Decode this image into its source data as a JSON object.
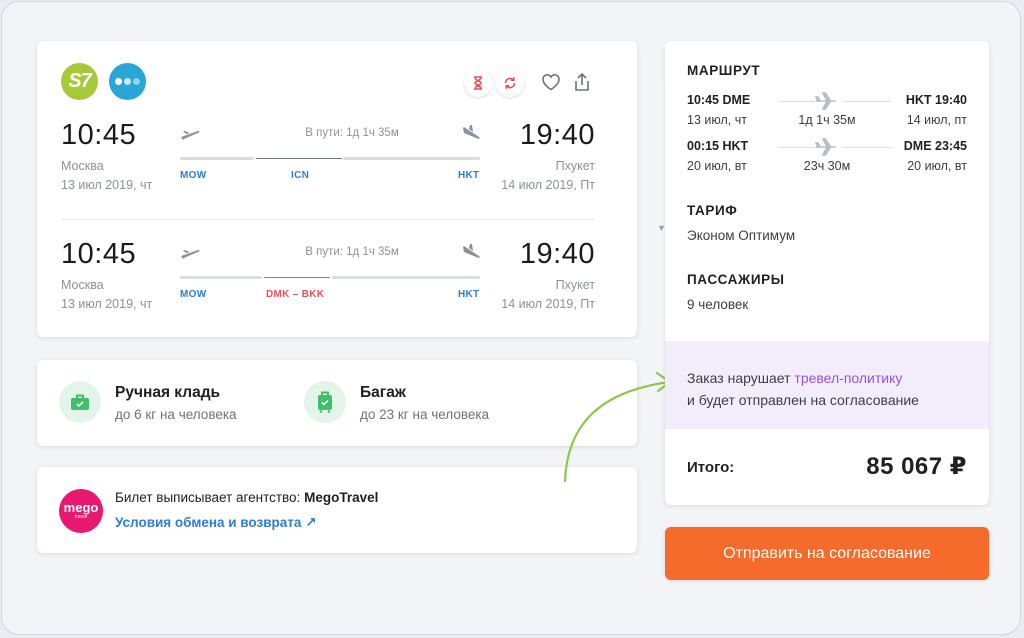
{
  "flight": {
    "airlines": [
      {
        "name": "S7",
        "color": "#a6c93a",
        "logo_text": "S7"
      },
      {
        "name": "partner-airline",
        "color": "#2aa6d6"
      }
    ],
    "actions": [
      "hourglass-icon",
      "refresh-icon",
      "heart-icon",
      "share-icon"
    ],
    "legs": [
      {
        "dep_time": "10:45",
        "dep_city": "Москва",
        "dep_date": "13 июл 2019, чт",
        "arr_time": "19:40",
        "arr_city": "Пхукет",
        "arr_date": "14 июл 2019, Пт",
        "duration": "В пути: 1д 1ч 35м",
        "origin_code": "MOW",
        "transfer": "ICN",
        "dest_code": "HKT",
        "transfer_warning": false
      },
      {
        "dep_time": "10:45",
        "dep_city": "Москва",
        "dep_date": "13 июл 2019, чт",
        "arr_time": "19:40",
        "arr_city": "Пхукет",
        "arr_date": "14 июл 2019, Пт",
        "duration": "В пути: 1д 1ч 35м",
        "origin_code": "MOW",
        "transfer": "DMK – BKK",
        "dest_code": "HKT",
        "transfer_warning": true
      }
    ]
  },
  "baggage": {
    "carry_on": {
      "title": "Ручная кладь",
      "subtitle": "до 6 кг на человека"
    },
    "checked": {
      "title": "Багаж",
      "subtitle": "до 23 кг на человека"
    }
  },
  "agency": {
    "logo_text": "mego",
    "logo_sub": "travel",
    "prefix": "Билет выписывает агентство: ",
    "name": "MegoTravel",
    "link": "Условия обмена и возврата ↗"
  },
  "summary": {
    "route_heading": "МАРШРУТ",
    "route_rows": [
      {
        "dep": "10:45 DME",
        "dep_date": "13 июл, чт",
        "dur": "1д 1ч 35м",
        "arr": "HKT 19:40",
        "arr_date": "14 июл, пт"
      },
      {
        "dep": "00:15 HKT",
        "dep_date": "20 июл, вт",
        "dur": "23ч 30м",
        "arr": "DME 23:45",
        "arr_date": "20 июл, вт"
      }
    ],
    "tariff_heading": "ТАРИФ",
    "tariff": "Эконом Оптимум",
    "passengers_heading": "ПАССАЖИРЫ",
    "passengers": "9 человек",
    "policy_prefix": "Заказ нарушает ",
    "policy_link": "тревел-политику",
    "policy_suffix": "и будет отправлен на согласование",
    "total_label": "Итого:",
    "total_value": "85 067 ₽"
  },
  "submit_label": "Отправить на согласование",
  "colors": {
    "accent": "#f46b2b",
    "link": "#2f7dd3",
    "policy": "#9553d6",
    "warning": "#e5525a",
    "annotation_arrow": "#8cc84b"
  }
}
